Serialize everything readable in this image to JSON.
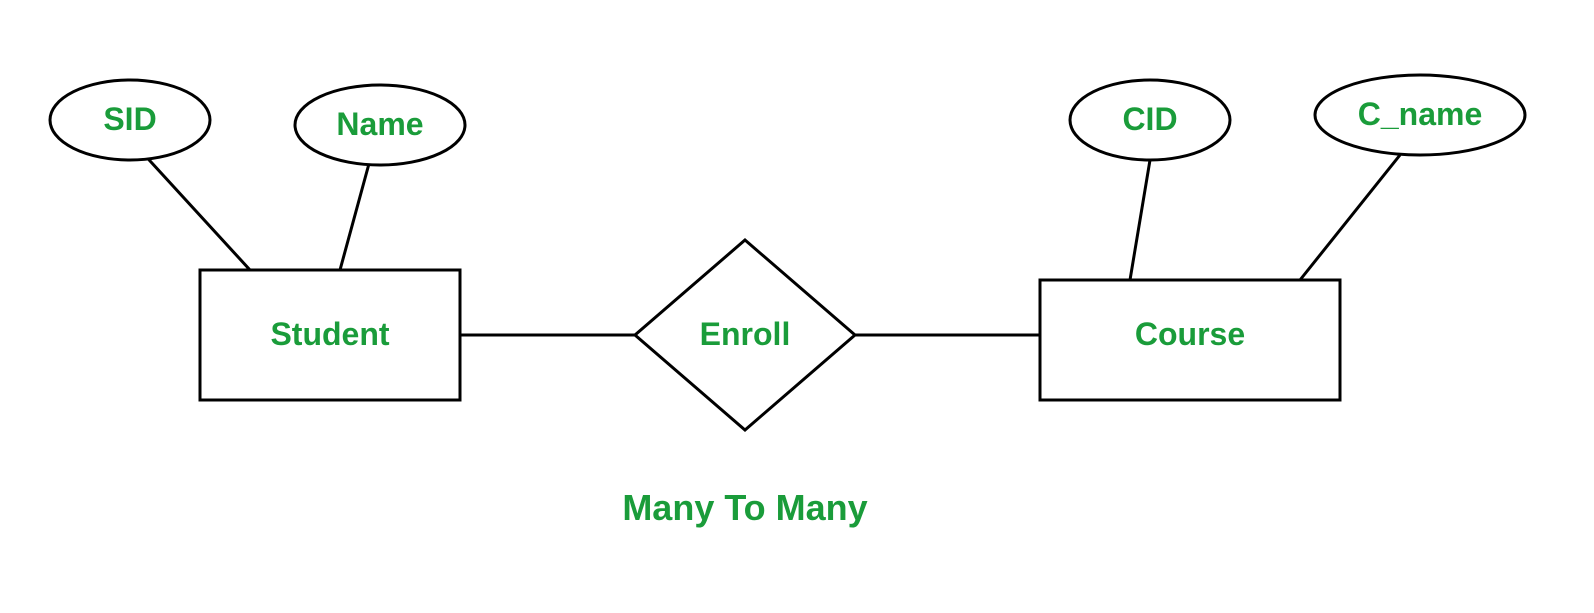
{
  "entities": {
    "student": {
      "label": "Student",
      "attributes": {
        "sid": "SID",
        "name": "Name"
      }
    },
    "course": {
      "label": "Course",
      "attributes": {
        "cid": "CID",
        "cname": "C_name"
      }
    }
  },
  "relationship": {
    "label": "Enroll"
  },
  "caption": "Many To Many"
}
